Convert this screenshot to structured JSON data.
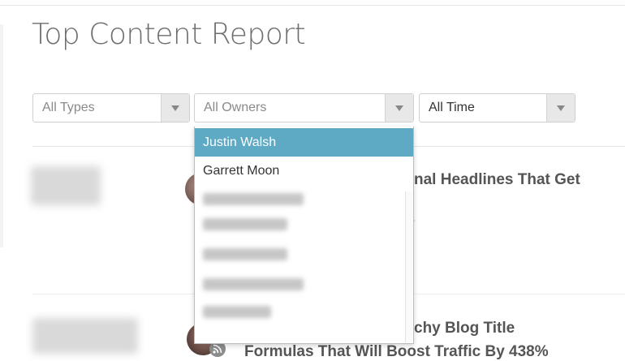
{
  "page": {
    "title": "Top Content Report"
  },
  "filters": {
    "types": {
      "value": "All Types",
      "icon": "caret-down-icon"
    },
    "owners": {
      "value": "All Owners",
      "icon": "caret-down-icon"
    },
    "time": {
      "value": "All Time",
      "icon": "caret-down-icon"
    }
  },
  "owners_dropdown": {
    "selected": "Justin Walsh",
    "items": [
      "Justin Walsh",
      "Garrett Moon"
    ],
    "hidden_item_count": 5
  },
  "articles": [
    {
      "title": "nal Headlines That Get",
      "icon": "avatar"
    },
    {
      "title_line1": "chy Blog Title",
      "title_line2": "Formulas That Will Boost Traffic By 438%",
      "icon": "rss-icon"
    }
  ],
  "colors": {
    "highlight": "#5ea9c4",
    "title_text": "#555555"
  }
}
